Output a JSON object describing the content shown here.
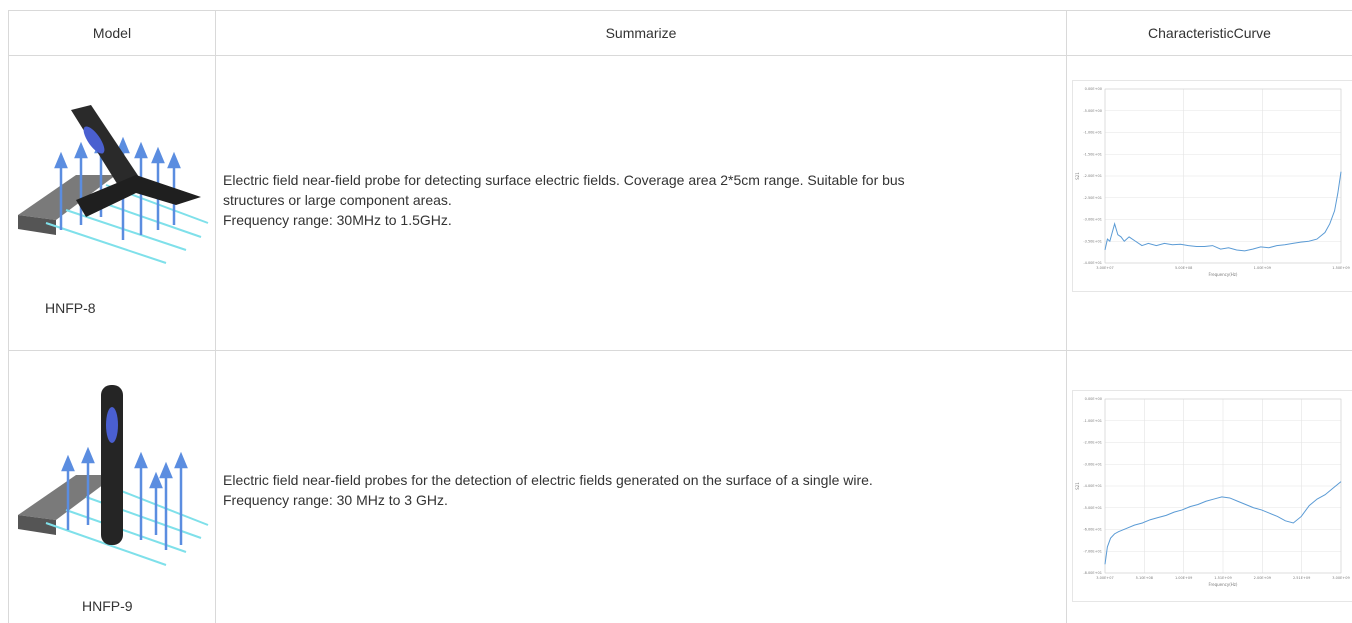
{
  "table": {
    "headers": {
      "model": "Model",
      "summarize": "Summarize",
      "curve": "CharacteristicCurve"
    },
    "rows": [
      {
        "model": "HNFP-8",
        "summary_lines": [
          "Electric field near-field probe for detecting surface electric fields. Coverage area 2*5cm range. Suitable for bus",
          "structures or large component areas.",
          "Frequency range: 30MHz to 1.5GHz."
        ],
        "chart_data": {
          "type": "line",
          "xlabel": "Frequency(Hz)",
          "ylabel": "S21",
          "yticks": [
            "0.00E+00",
            "-5.00E+00",
            "-1.00E+01",
            "-1.50E+01",
            "-2.00E+01",
            "-2.50E+01",
            "-3.00E+01",
            "-3.50E+01",
            "-4.00E+01"
          ],
          "xticks": [
            "3.00E+07",
            "5.00E+08",
            "1.00E+09",
            "1.50E+09"
          ],
          "ylim": [
            -40,
            0
          ],
          "xlim": [
            30000000,
            1500000000
          ],
          "grid": true,
          "color": "#5b9bd5",
          "series": [
            {
              "x": [
                30000000,
                45000000,
                60000000,
                75000000,
                90000000,
                110000000,
                130000000,
                150000000,
                180000000,
                220000000,
                260000000,
                300000000,
                350000000,
                400000000,
                450000000,
                500000000,
                550000000,
                600000000,
                650000000,
                700000000,
                750000000,
                800000000,
                850000000,
                900000000,
                950000000,
                1000000000,
                1050000000,
                1100000000,
                1150000000,
                1200000000,
                1250000000,
                1300000000,
                1350000000,
                1400000000,
                1430000000,
                1460000000,
                1480000000,
                1500000000
              ],
              "y": [
                -37,
                -34.5,
                -35,
                -33,
                -31,
                -33.5,
                -34,
                -35,
                -34,
                -35,
                -36,
                -35.5,
                -36,
                -35.5,
                -35.8,
                -35.7,
                -36,
                -36.2,
                -36.2,
                -36,
                -36.8,
                -36.5,
                -37,
                -37.2,
                -36.8,
                -36.3,
                -36.5,
                -36,
                -35.8,
                -35.5,
                -35.2,
                -35,
                -34.5,
                -33,
                -31,
                -28,
                -24,
                -19
              ]
            }
          ]
        }
      },
      {
        "model": "HNFP-9",
        "summary_lines": [
          "Electric field near-field probes for the detection of electric fields generated on the surface of a single wire.",
          "Frequency range: 30 MHz to 3 GHz."
        ],
        "chart_data": {
          "type": "line",
          "xlabel": "Frequency(Hz)",
          "ylabel": "S21",
          "yticks": [
            "0.00E+00",
            "-1.00E+01",
            "-2.00E+01",
            "-3.00E+01",
            "-4.00E+01",
            "-5.00E+01",
            "-6.00E+01",
            "-7.00E+01",
            "-8.00E+01"
          ],
          "xticks": [
            "3.00E+07",
            "5.10E+08",
            "1.00E+09",
            "1.51E+09",
            "2.00E+09",
            "2.51E+09",
            "3.00E+09"
          ],
          "ylim": [
            -80,
            0
          ],
          "xlim": [
            30000000,
            3000000000
          ],
          "grid": true,
          "color": "#5b9bd5",
          "series": [
            {
              "x": [
                30000000,
                60000000,
                100000000,
                150000000,
                200000000,
                300000000,
                400000000,
                500000000,
                600000000,
                700000000,
                800000000,
                900000000,
                1000000000,
                1100000000,
                1200000000,
                1300000000,
                1400000000,
                1500000000,
                1600000000,
                1700000000,
                1800000000,
                1900000000,
                2000000000,
                2100000000,
                2200000000,
                2300000000,
                2400000000,
                2500000000,
                2600000000,
                2700000000,
                2800000000,
                2900000000,
                3000000000
              ],
              "y": [
                -76,
                -68,
                -64,
                -62,
                -61,
                -59.5,
                -58,
                -57,
                -55.5,
                -54.5,
                -53.5,
                -52,
                -51,
                -49.5,
                -48.5,
                -47,
                -46,
                -45,
                -45.5,
                -47,
                -48.5,
                -50,
                -51,
                -52.5,
                -54,
                -56,
                -57,
                -54,
                -49,
                -46,
                -44,
                -41,
                -38
              ]
            }
          ]
        }
      }
    ]
  }
}
